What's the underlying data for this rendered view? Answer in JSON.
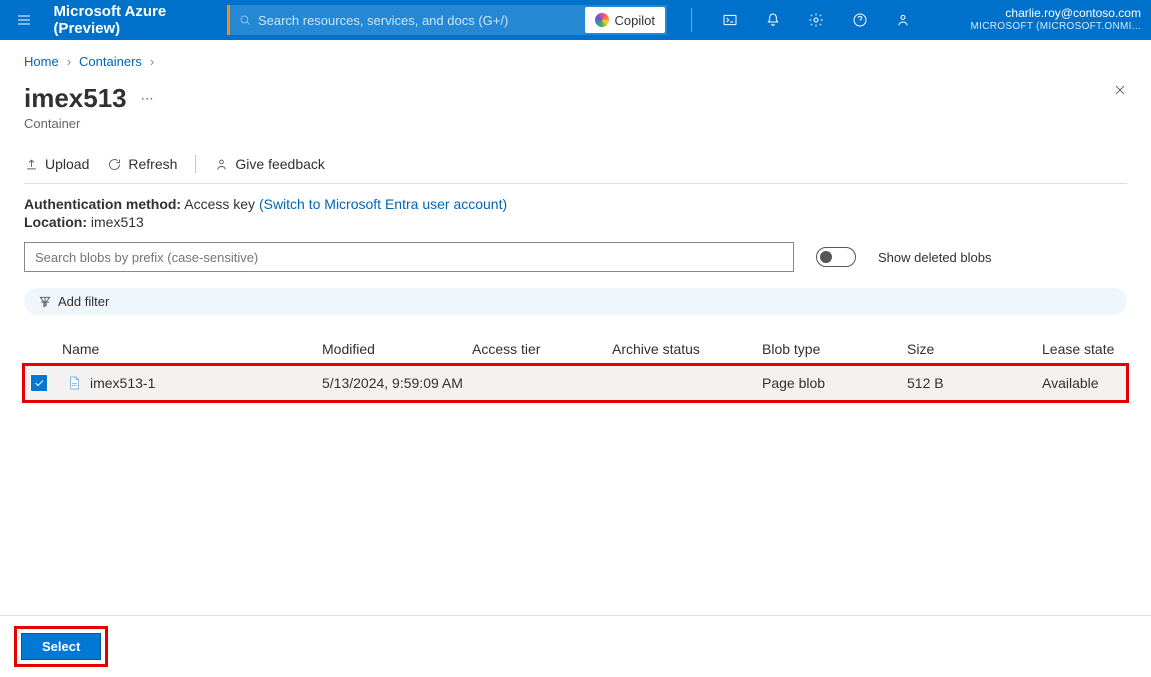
{
  "header": {
    "brand": "Microsoft Azure (Preview)",
    "search_placeholder": "Search resources, services, and docs (G+/)",
    "copilot_label": "Copilot",
    "account_email": "charlie.roy@contoso.com",
    "account_directory": "MICROSOFT (MICROSOFT.ONMI..."
  },
  "breadcrumbs": {
    "home": "Home",
    "containers": "Containers"
  },
  "page_title": "imex513",
  "page_subtitle": "Container",
  "toolbar": {
    "upload": "Upload",
    "refresh": "Refresh",
    "feedback": "Give feedback"
  },
  "info": {
    "auth_label": "Authentication method:",
    "auth_value": "Access key",
    "auth_switch": "(Switch to Microsoft Entra user account)",
    "location_label": "Location:",
    "location_value": "imex513"
  },
  "search_blobs_placeholder": "Search blobs by prefix (case-sensitive)",
  "show_deleted_label": "Show deleted blobs",
  "add_filter_label": "Add filter",
  "columns": {
    "name": "Name",
    "modified": "Modified",
    "access_tier": "Access tier",
    "archive_status": "Archive status",
    "blob_type": "Blob type",
    "size": "Size",
    "lease_state": "Lease state"
  },
  "rows": [
    {
      "name": "imex513-1",
      "modified": "5/13/2024, 9:59:09 AM",
      "access_tier": "",
      "archive_status": "",
      "blob_type": "Page blob",
      "size": "512 B",
      "lease_state": "Available"
    }
  ],
  "footer": {
    "select": "Select"
  }
}
